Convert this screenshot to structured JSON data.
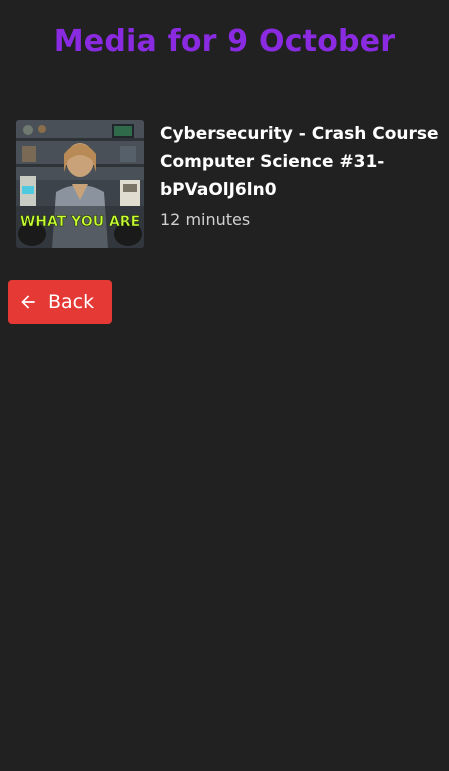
{
  "page": {
    "title": "Media for 9 October",
    "accent_color": "#8a2be2"
  },
  "media_items": [
    {
      "title": "Cybersecurity - Crash Course Computer Science #31-bPVaOlJ6ln0",
      "duration": "12 minutes",
      "thumbnail_caption": "WHAT YOU ARE",
      "thumbnail_icon": "video-thumbnail"
    }
  ],
  "back_button": {
    "label": "Back",
    "icon": "arrow-left-icon",
    "color": "#e53935"
  }
}
